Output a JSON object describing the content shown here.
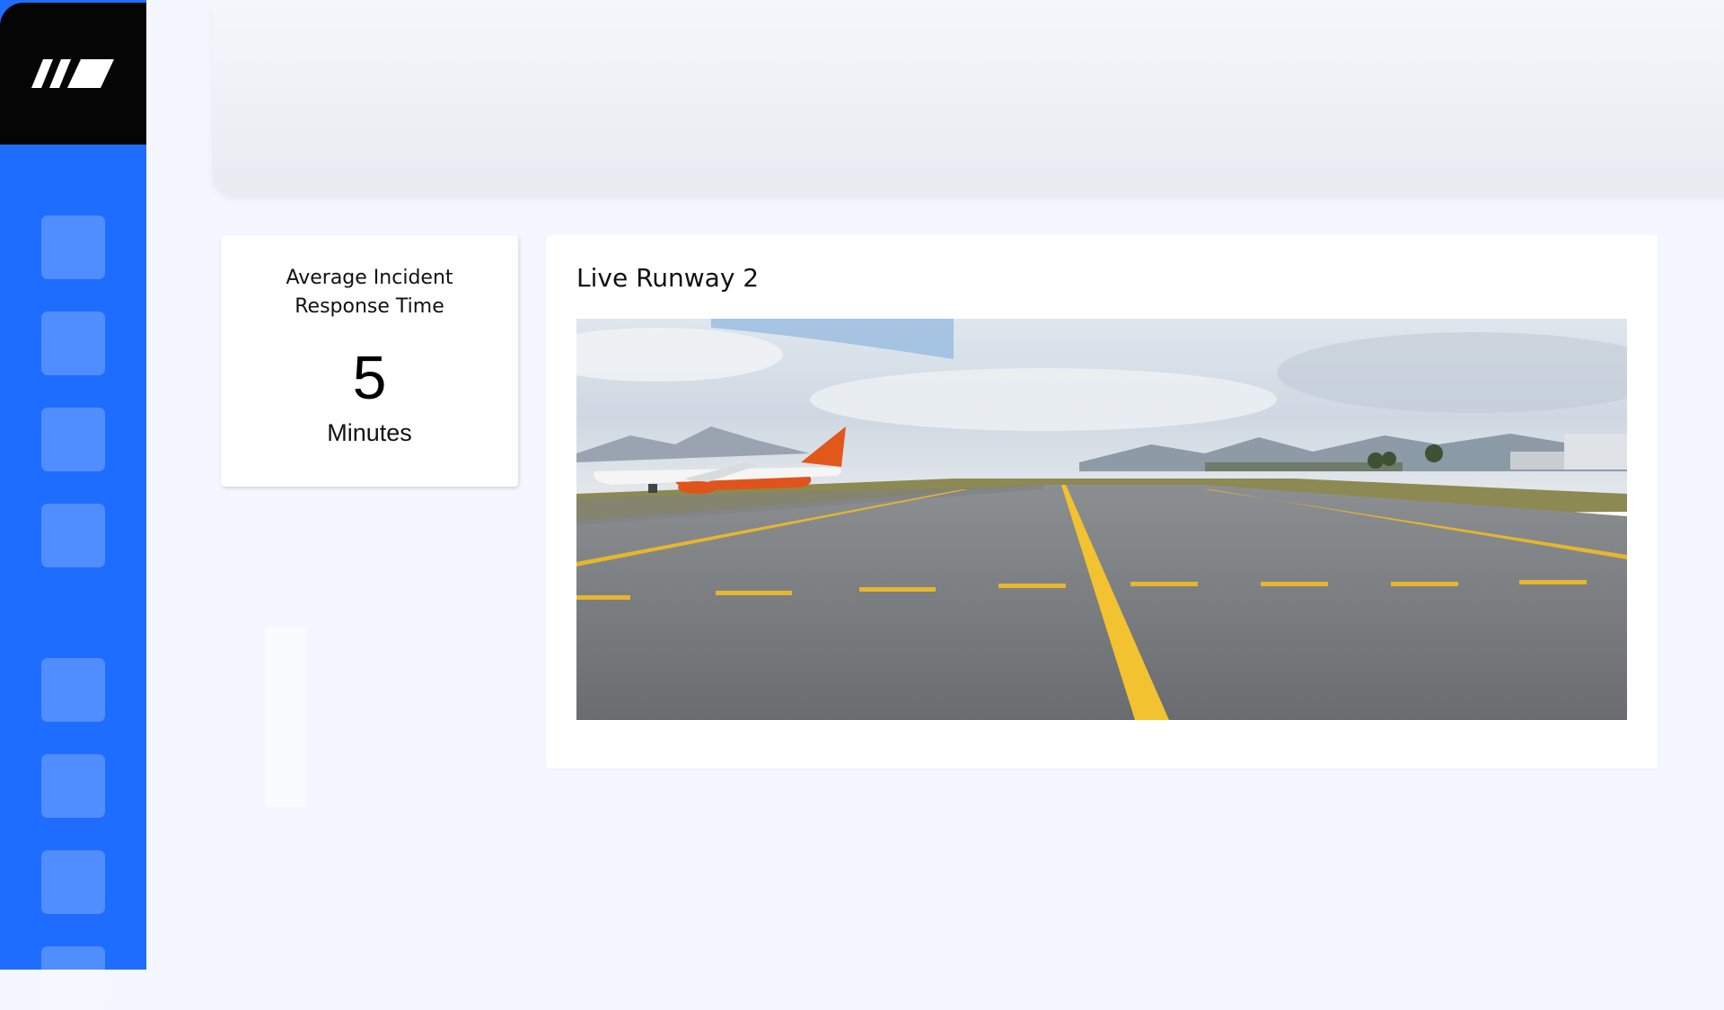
{
  "sidebar": {
    "logo_icon": "brand-logo-icon",
    "items": [
      {
        "icon": "nav-placeholder-icon"
      },
      {
        "icon": "nav-placeholder-icon"
      },
      {
        "icon": "nav-placeholder-icon"
      },
      {
        "icon": "nav-placeholder-icon"
      },
      {
        "icon": "nav-placeholder-icon"
      },
      {
        "icon": "nav-placeholder-icon"
      },
      {
        "icon": "nav-placeholder-icon"
      },
      {
        "icon": "nav-placeholder-icon"
      }
    ]
  },
  "kpi": {
    "title": "Average Incident Response Time",
    "value": "5",
    "unit": "Minutes"
  },
  "runway": {
    "title": "Live Runway 2"
  },
  "colors": {
    "sidebar": "#1f6dff",
    "logo_bg": "#050505",
    "page_bg": "#f4f7ff",
    "runway_line": "#f2c230"
  }
}
